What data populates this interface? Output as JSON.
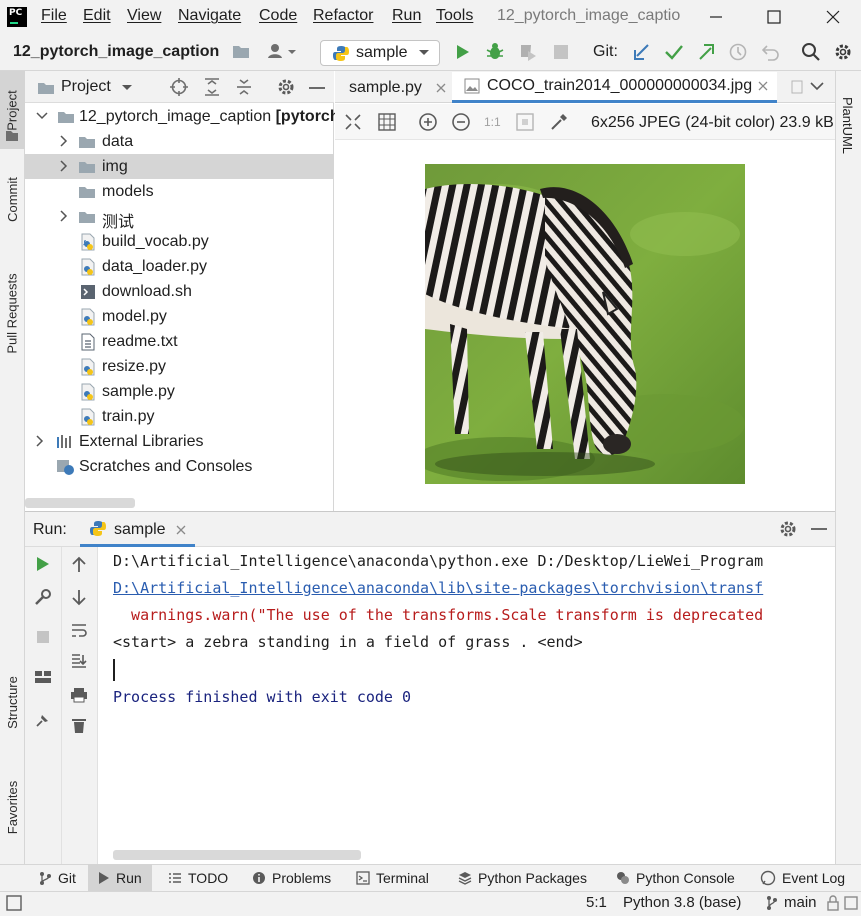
{
  "menu": {
    "items": [
      "File",
      "Edit",
      "View",
      "Navigate",
      "Code",
      "Refactor",
      "Run",
      "Tools"
    ],
    "window_title": "12_pytorch_image_captio"
  },
  "navbar": {
    "project": "12_pytorch_image_caption",
    "run_config": "sample",
    "git_label": "Git:"
  },
  "left_stripe": [
    "Project",
    "Commit",
    "Pull Requests",
    "Structure",
    "Favorites"
  ],
  "right_stripe": [
    "PlantUML"
  ],
  "project_panel": {
    "title": "Project",
    "root_name": "12_pytorch_image_caption",
    "root_suffix": "[pytorch",
    "items": [
      {
        "label": "data",
        "kind": "folder",
        "expandable": true
      },
      {
        "label": "img",
        "kind": "folder",
        "expandable": true,
        "selected": true
      },
      {
        "label": "models",
        "kind": "folder",
        "expandable": false
      },
      {
        "label": "测试",
        "kind": "folder",
        "expandable": true
      },
      {
        "label": "build_vocab.py",
        "kind": "python"
      },
      {
        "label": "data_loader.py",
        "kind": "python"
      },
      {
        "label": "download.sh",
        "kind": "shell"
      },
      {
        "label": "model.py",
        "kind": "python"
      },
      {
        "label": "readme.txt",
        "kind": "text"
      },
      {
        "label": "resize.py",
        "kind": "python"
      },
      {
        "label": "sample.py",
        "kind": "python"
      },
      {
        "label": "train.py",
        "kind": "python"
      }
    ],
    "external_libraries": "External Libraries",
    "scratches": "Scratches and Consoles"
  },
  "editor": {
    "tabs": [
      {
        "label": "sample.py",
        "active": false
      },
      {
        "label": "COCO_train2014_000000000034.jpg",
        "active": true
      }
    ],
    "zoom_actual": "1:1",
    "image_info": "6x256 JPEG (24-bit color) 23.9 kB"
  },
  "run_panel": {
    "label": "Run:",
    "tab": "sample",
    "console": [
      {
        "text": "D:\\Artificial_Intelligence\\anaconda\\python.exe D:/Desktop/LieWei_Program",
        "style": "cmd"
      },
      {
        "text": "D:\\Artificial_Intelligence\\anaconda\\lib\\site-packages\\torchvision\\transf",
        "style": "link"
      },
      {
        "text": "  warnings.warn(\"The use of the transforms.Scale transform is deprecated",
        "style": "warn"
      },
      {
        "text": "<start> a zebra standing in a field of grass . <end>",
        "style": "out"
      },
      {
        "text": "",
        "style": "out"
      },
      {
        "text": "Process finished with exit code 0",
        "style": "exit"
      }
    ]
  },
  "bottom_tabs": [
    "Git",
    "Run",
    "TODO",
    "Problems",
    "Terminal",
    "Python Packages",
    "Python Console",
    "Event Log"
  ],
  "status": {
    "position": "5:1",
    "interpreter": "Python 3.8 (base)",
    "branch": "main"
  },
  "colors": {
    "accent": "#4083c9",
    "run_green": "#43a047",
    "console_link": "#2a5db0",
    "console_warn": "#b71c1c",
    "console_exit": "#1a237e"
  }
}
